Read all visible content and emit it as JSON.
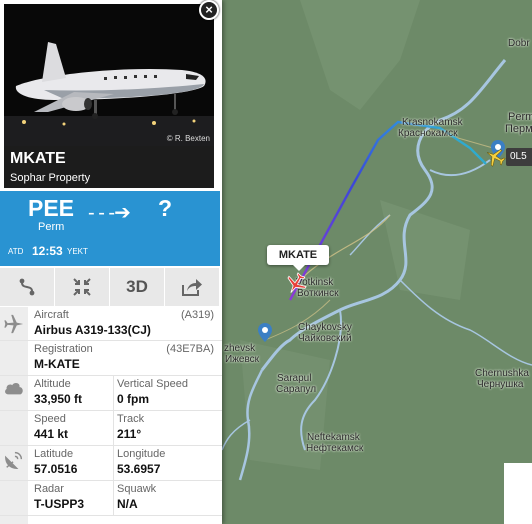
{
  "flight_tag": "MKATE",
  "other_tag": "0L5",
  "map_labels": [
    {
      "name": "city-dobrl",
      "text": "Dobr"
    },
    {
      "name": "city-perm-en",
      "text": "Perm"
    },
    {
      "name": "city-perm-ru",
      "text": "Перм"
    },
    {
      "name": "city-krasnokamsk-en",
      "text": "Krasnokamsk"
    },
    {
      "name": "city-krasnokamsk-ru",
      "text": "Краснокамск"
    },
    {
      "name": "city-votkinsk-en",
      "text": "Votkinsk"
    },
    {
      "name": "city-votkinsk-ru",
      "text": "Воткинск"
    },
    {
      "name": "city-chaykovsky-en",
      "text": "Chaykovsky"
    },
    {
      "name": "city-chaykovsky-ru",
      "text": "Чайковский"
    },
    {
      "name": "city-izhevsk-en",
      "text": "zhevsk"
    },
    {
      "name": "city-izhevsk-ru",
      "text": "Ижевск"
    },
    {
      "name": "city-sarapul-en",
      "text": "Sarapul"
    },
    {
      "name": "city-sarapul-ru",
      "text": "Сарапул"
    },
    {
      "name": "city-chernushka-en",
      "text": "Chernushka"
    },
    {
      "name": "city-chernushka-ru",
      "text": "Чернушка"
    },
    {
      "name": "city-neftekamsk-en",
      "text": "Neftekamsk"
    },
    {
      "name": "city-neftekamsk-ru",
      "text": "Нефтекамск"
    }
  ],
  "panel": {
    "close": "×",
    "photo_credit": "© R. Bexten",
    "callsign": "MKATE",
    "airline": "Sophar Property",
    "origin_code": "PEE",
    "origin_city": "Perm",
    "arrow": "- - -➔",
    "dest_code": "?",
    "atd_label": "ATD",
    "atd_time": "12:53",
    "atd_tz": "YEKT",
    "tools": {
      "route": "route-icon",
      "collapse": "collapse-icon",
      "three_d": "3D",
      "share": "share-icon"
    },
    "aircraft_label": "Aircraft",
    "aircraft_code": "(A319)",
    "aircraft_value": "Airbus A319-133(CJ)",
    "registration_label": "Registration",
    "registration_code": "(43E7BA)",
    "registration_value": "M-KATE",
    "altitude_label": "Altitude",
    "altitude_value": "33,950 ft",
    "vspeed_label": "Vertical Speed",
    "vspeed_value": "0 fpm",
    "speed_label": "Speed",
    "speed_value": "441 kt",
    "track_label": "Track",
    "track_value": "211°",
    "latitude_label": "Latitude",
    "latitude_value": "57.0516",
    "longitude_label": "Longitude",
    "longitude_value": "53.6957",
    "radar_label": "Radar",
    "radar_value": "T-USPP3",
    "squawk_label": "Squawk",
    "squawk_value": "N/A"
  }
}
